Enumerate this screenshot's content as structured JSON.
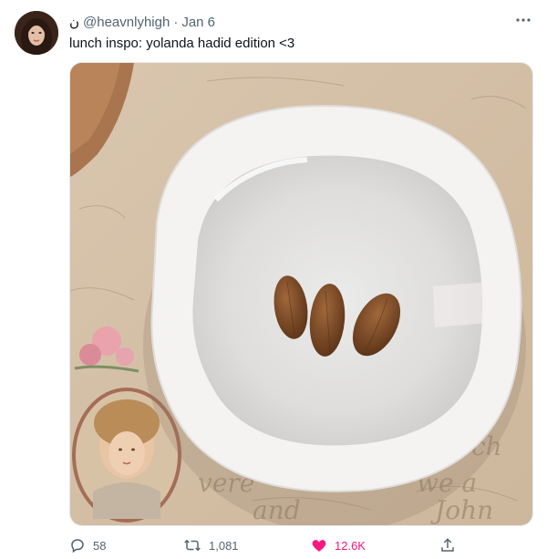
{
  "tweet": {
    "display_name": "ن",
    "handle": "@heavnlyhigh",
    "separator": "·",
    "date": "Jan 6",
    "text": "lunch inspo: yolanda hadid edition <3",
    "more_icon": "more-horizontal-icon",
    "image_description_icon": "photo"
  },
  "actions": {
    "replies": "58",
    "retweets": "1,081",
    "likes": "12.6K",
    "like_color": "#f91880",
    "icons": [
      "reply-icon",
      "retweet-icon",
      "heart-icon",
      "share-icon"
    ]
  }
}
